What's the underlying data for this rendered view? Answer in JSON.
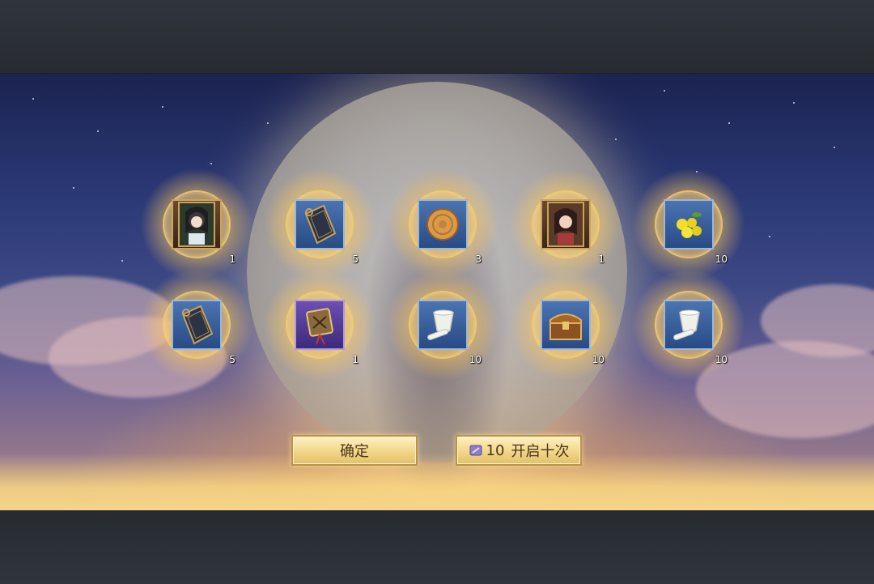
{
  "buttons": {
    "confirm_label": "确定",
    "open_ten_cost": "10",
    "open_ten_label": "开启十次"
  },
  "rewards": [
    {
      "name": "portrait-card",
      "count": "1",
      "frame": "brown"
    },
    {
      "name": "jade-token",
      "count": "5",
      "frame": "blue"
    },
    {
      "name": "mooncake",
      "count": "3",
      "frame": "blue"
    },
    {
      "name": "portrait-card",
      "count": "1",
      "frame": "brown"
    },
    {
      "name": "osmanthus-flower",
      "count": "10",
      "frame": "blue"
    },
    {
      "name": "jade-token",
      "count": "5",
      "frame": "blue"
    },
    {
      "name": "ornament-charm",
      "count": "1",
      "frame": "purple"
    },
    {
      "name": "mortar-pestle",
      "count": "10",
      "frame": "blue"
    },
    {
      "name": "treasure-chest",
      "count": "10",
      "frame": "blue"
    },
    {
      "name": "mortar-pestle",
      "count": "10",
      "frame": "blue"
    }
  ],
  "colors": {
    "button_text": "#4a3418",
    "glow": "#ffd98a"
  }
}
